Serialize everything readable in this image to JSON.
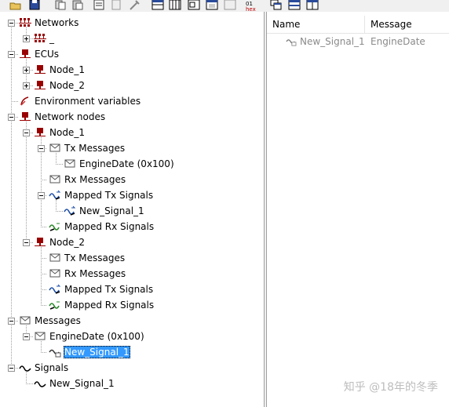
{
  "toolbar": {
    "buttons": [
      "open-icon",
      "save-icon",
      "copy-icon",
      "paste-icon",
      "properties-icon",
      "doc-icon",
      "tool-icon",
      "table-icon",
      "columns-icon",
      "frame-icon",
      "window-icon",
      "image-icon",
      "hex-icon",
      "cascade-icon",
      "split-horizontal-icon",
      "split-vertical-icon"
    ]
  },
  "tree": {
    "networks": "Networks",
    "network_item": "_",
    "ecus": "ECUs",
    "ecu_node1": "Node_1",
    "ecu_node2": "Node_2",
    "env_vars": "Environment variables",
    "network_nodes": "Network nodes",
    "nn_node1": "Node_1",
    "nn1_tx": "Tx Messages",
    "nn1_tx_engine": "EngineDate (0x100)",
    "nn1_rx": "Rx Messages",
    "nn1_mapped_tx": "Mapped Tx Signals",
    "nn1_mapped_tx_sig": "New_Signal_1",
    "nn1_mapped_rx": "Mapped Rx Signals",
    "nn_node2": "Node_2",
    "nn2_tx": "Tx Messages",
    "nn2_rx": "Rx Messages",
    "nn2_mapped_tx": "Mapped Tx Signals",
    "nn2_mapped_rx": "Mapped Rx Signals",
    "messages": "Messages",
    "msg_engine": "EngineDate (0x100)",
    "msg_engine_sig": "New_Signal_1",
    "signals": "Signals",
    "sig_new": "New_Signal_1"
  },
  "list": {
    "columns": {
      "name": "Name",
      "message": "Message"
    },
    "rows": [
      {
        "name": "New_Signal_1",
        "message": "EngineDate"
      }
    ]
  },
  "watermark": "知乎 @18年的冬季",
  "colors": {
    "selection": "#3399ff",
    "network_icon": "#990000",
    "signal_icon_blue": "#1f4fa8",
    "signal_icon_green": "#2a8a2a"
  }
}
